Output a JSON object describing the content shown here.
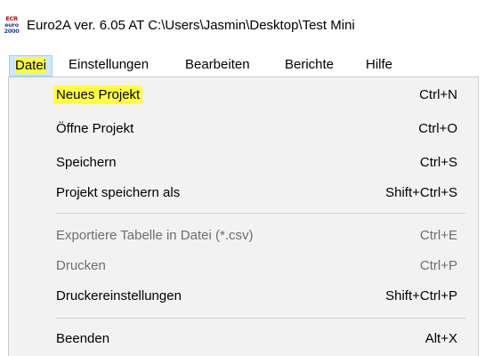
{
  "window": {
    "icon_lines": [
      "ECR",
      "euro",
      "2000"
    ],
    "title": "Euro2A ver. 6.05 AT   C:\\Users\\Jasmin\\Desktop\\Test Mini"
  },
  "menubar": {
    "items": [
      {
        "label": "Datei"
      },
      {
        "label": "Einstellungen"
      },
      {
        "label": "Bearbeiten"
      },
      {
        "label": "Berichte"
      },
      {
        "label": "Hilfe"
      }
    ]
  },
  "dropdown": {
    "items": [
      {
        "label": "Neues Projekt",
        "shortcut": "Ctrl+N",
        "enabled": true,
        "highlighted": true
      },
      {
        "label": "Öffne Projekt",
        "shortcut": "Ctrl+O",
        "enabled": true
      },
      {
        "label": "Speichern",
        "shortcut": "Ctrl+S",
        "enabled": true
      },
      {
        "label": "Projekt speichern als",
        "shortcut": "Shift+Ctrl+S",
        "enabled": true
      },
      {
        "label": "Exportiere Tabelle in Datei (*.csv)",
        "shortcut": "Ctrl+E",
        "enabled": false
      },
      {
        "label": "Drucken",
        "shortcut": "Ctrl+P",
        "enabled": false
      },
      {
        "label": "Druckereinstellungen",
        "shortcut": "Shift+Ctrl+P",
        "enabled": true
      },
      {
        "label": "Beenden",
        "shortcut": "Alt+X",
        "enabled": true
      }
    ]
  },
  "colors": {
    "highlight": "#ffff3d",
    "menu_active_bg": "#cce8ff",
    "dropdown_bg": "#f2f2f2",
    "disabled_text": "#6d6d6d"
  }
}
